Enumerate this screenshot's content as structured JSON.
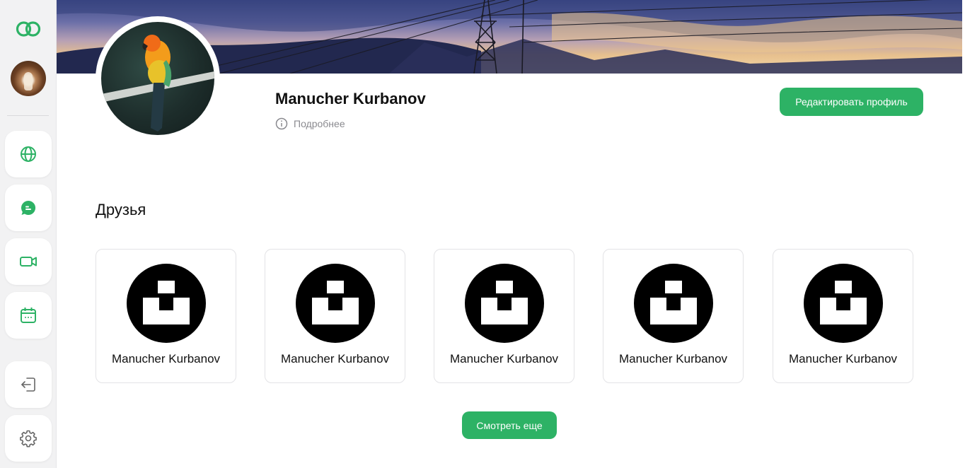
{
  "app": {
    "accent_color": "#2db265"
  },
  "sidebar": {
    "logo_icon": "two-rings-logo",
    "nav": [
      {
        "name": "globe",
        "icon": "globe-icon"
      },
      {
        "name": "chat",
        "icon": "chat-bubble-icon"
      },
      {
        "name": "video",
        "icon": "video-camera-icon"
      },
      {
        "name": "calendar",
        "icon": "calendar-icon"
      },
      {
        "name": "logout",
        "icon": "logout-icon"
      },
      {
        "name": "settings",
        "icon": "gear-icon"
      }
    ]
  },
  "profile": {
    "name": "Manucher Kurbanov",
    "more_label": "Подробнее",
    "edit_label": "Редактировать профиль"
  },
  "friends": {
    "title": "Друзья",
    "items": [
      {
        "name": "Manucher Kurbanov"
      },
      {
        "name": "Manucher Kurbanov"
      },
      {
        "name": "Manucher Kurbanov"
      },
      {
        "name": "Manucher Kurbanov"
      },
      {
        "name": "Manucher Kurbanov"
      }
    ],
    "show_more_label": "Смотреть еще"
  }
}
